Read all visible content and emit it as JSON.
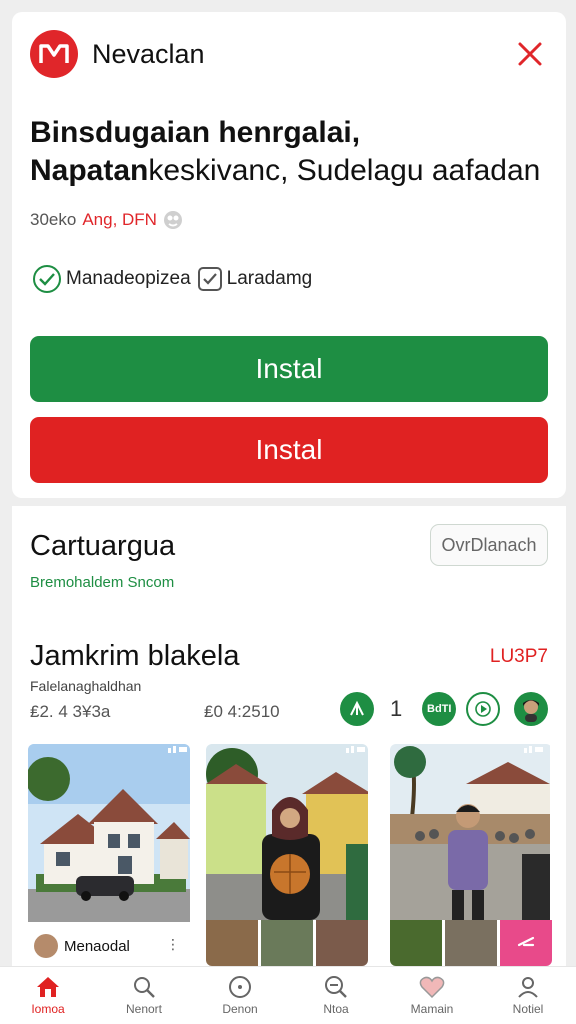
{
  "app": {
    "name": "Nevaclan",
    "logo_letter": "M",
    "brand_color": "#e0262a"
  },
  "headline": {
    "line1": "Binsdugaian henrgalai,",
    "line2_bold": "Napatan",
    "line2_rest": "keskivanc, Sudelagu aafadan"
  },
  "meta": {
    "prefix": "30eko",
    "highlight": "Ang, DFN"
  },
  "checks": [
    {
      "label": "Manadeopizea",
      "checked": true
    },
    {
      "label": "Laradamg",
      "checked": true
    }
  ],
  "buttons": {
    "primary": "Instal",
    "secondary": "Instal",
    "primary_color": "#1e8e43",
    "secondary_color": "#e02222"
  },
  "section": {
    "title": "Cartuargua",
    "subtitle": "Bremohaldem Sncom",
    "action": "OvrDlanach"
  },
  "feature": {
    "title": "Jamkrim blakela",
    "code": "LU3P7",
    "subtitle": "Falelanaghaldhan",
    "stat1": "₤2. 4 3¥3a",
    "stat2": "₤0 4:2510",
    "count": "1",
    "badge": "BdTI"
  },
  "thumbnails": [
    {
      "caption": "Menaodal",
      "scene": "house"
    },
    {
      "scene": "woman-outdoor"
    },
    {
      "scene": "crowd"
    }
  ],
  "tabs": [
    {
      "label": "Iomoa",
      "icon": "home-icon",
      "active": true
    },
    {
      "label": "Nenort",
      "icon": "search-icon",
      "active": false
    },
    {
      "label": "Denon",
      "icon": "compass-icon",
      "active": false
    },
    {
      "label": "Ntoa",
      "icon": "magnify-icon",
      "active": false
    },
    {
      "label": "Mamain",
      "icon": "heart-icon",
      "active": false
    },
    {
      "label": "Notiel",
      "icon": "user-icon",
      "active": false
    }
  ]
}
